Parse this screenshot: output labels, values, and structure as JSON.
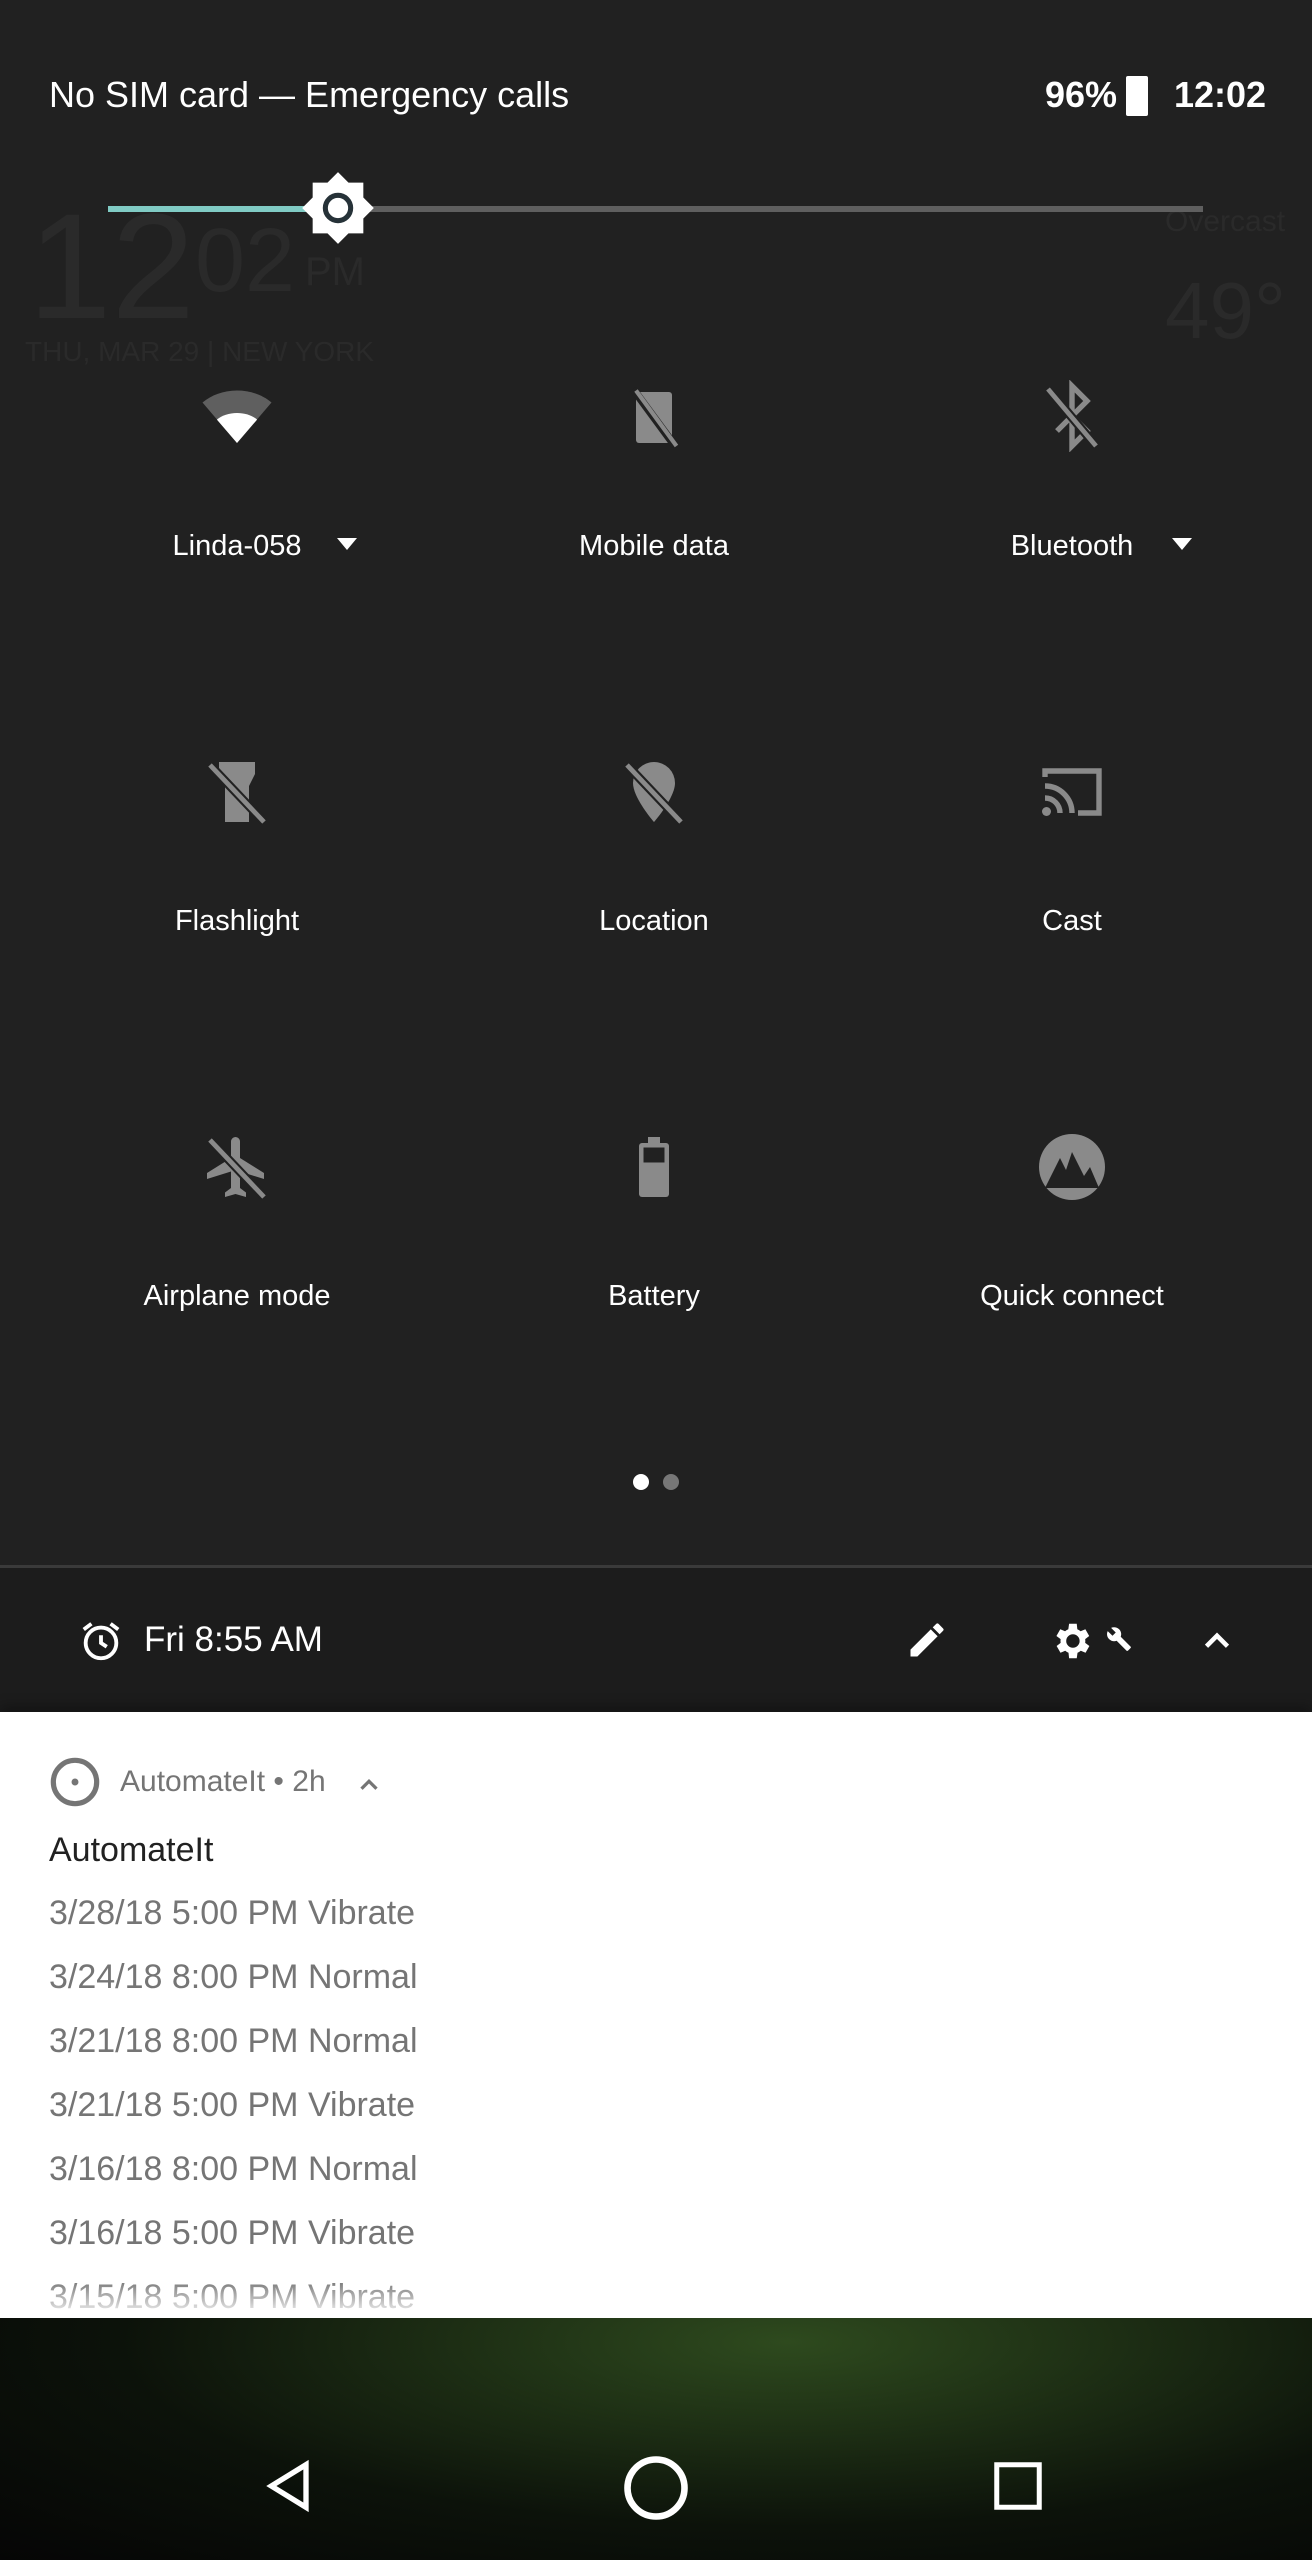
{
  "status_bar": {
    "carrier": "No SIM card — Emergency calls",
    "battery": "96%",
    "time": "12:02"
  },
  "brightness": {
    "level_percent": 21,
    "accent": "#80cbc4"
  },
  "background_widget": {
    "clock": "12",
    "minutes": "02",
    "ampm": "PM",
    "date": "THU, MAR 29 | NEW YORK",
    "condition": "Overcast",
    "temp": "49°"
  },
  "tiles": [
    {
      "label": "Linda-058",
      "icon": "wifi-icon",
      "dropdown": true
    },
    {
      "label": "Mobile data",
      "icon": "mobile-data-off-icon",
      "dropdown": false
    },
    {
      "label": "Bluetooth",
      "icon": "bluetooth-off-icon",
      "dropdown": true
    },
    {
      "label": "Flashlight",
      "icon": "flashlight-off-icon"
    },
    {
      "label": "Location",
      "icon": "location-off-icon"
    },
    {
      "label": "Cast",
      "icon": "cast-icon"
    },
    {
      "label": "Airplane mode",
      "icon": "airplane-off-icon"
    },
    {
      "label": "Battery",
      "icon": "battery-icon"
    },
    {
      "label": "Quick connect",
      "icon": "quick-connect-icon"
    }
  ],
  "pages": {
    "count": 2,
    "current": 1
  },
  "footer": {
    "alarm": "Fri 8:55 AM"
  },
  "notification": {
    "app": "AutomateIt",
    "age": "2h",
    "separator": "•",
    "title": "AutomateIt",
    "lines": [
      "3/28/18 5:00 PM Vibrate",
      "3/24/18 8:00 PM Normal",
      "3/21/18 8:00 PM Normal",
      "3/21/18 5:00 PM Vibrate",
      "3/16/18 8:00 PM Normal",
      "3/16/18 5:00 PM Vibrate",
      "3/15/18 5:00 PM Vibrate"
    ]
  }
}
